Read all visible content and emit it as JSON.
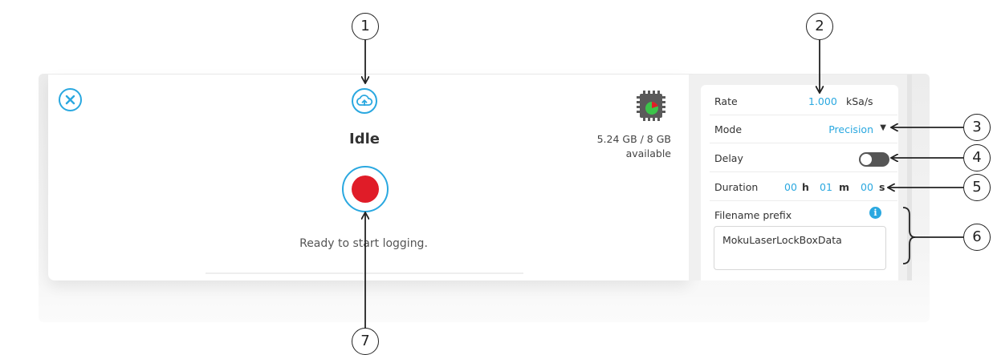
{
  "colors": {
    "accent": "#2aa8e0",
    "record": "#e01c28",
    "toggle_off": "#555555"
  },
  "left": {
    "status": "Idle",
    "ready_text": "Ready to start logging.",
    "storage_line1": "5.24 GB / 8 GB",
    "storage_line2": "available",
    "icons": {
      "close": "close-icon",
      "upload": "cloud-upload-icon",
      "chip": "memory-chip-icon"
    }
  },
  "settings": {
    "rate_label": "Rate",
    "rate_value": "1.000",
    "rate_unit": "kSa/s",
    "mode_label": "Mode",
    "mode_value": "Precision",
    "delay_label": "Delay",
    "delay_enabled": false,
    "duration_label": "Duration",
    "duration_h": "00",
    "duration_h_unit": "h",
    "duration_m": "01",
    "duration_m_unit": "m",
    "duration_s": "00",
    "duration_s_unit": "s",
    "prefix_label": "Filename prefix",
    "prefix_value": "MokuLaserLockBoxData"
  },
  "callouts": [
    "1",
    "2",
    "3",
    "4",
    "5",
    "6",
    "7"
  ]
}
